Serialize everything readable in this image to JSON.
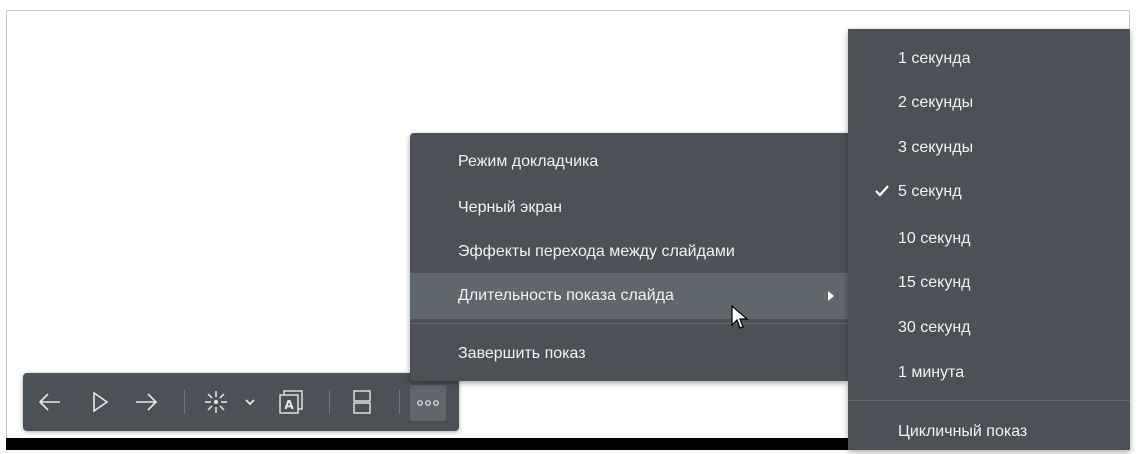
{
  "menu": {
    "items": [
      {
        "label": "Режим докладчика"
      },
      {
        "label": "Черный экран"
      },
      {
        "label": "Эффекты перехода между слайдами"
      },
      {
        "label": "Длительность показа слайда"
      },
      {
        "label": "Завершить показ"
      }
    ],
    "highlighted_index": 3
  },
  "submenu": {
    "items": [
      {
        "label": "1 секунда"
      },
      {
        "label": "2 секунды"
      },
      {
        "label": "3 секунды"
      },
      {
        "label": "5 секунд",
        "checked": true
      },
      {
        "label": "10 секунд"
      },
      {
        "label": "15 секунд"
      },
      {
        "label": "30 секунд"
      },
      {
        "label": "1 минута"
      },
      {
        "label": "Цикличный показ"
      }
    ]
  },
  "toolbar": {
    "buttons": [
      {
        "icon": "arrow-left-icon"
      },
      {
        "icon": "play-icon"
      },
      {
        "icon": "arrow-right-icon"
      },
      {
        "icon": "laser-pointer-icon"
      },
      {
        "icon": "chevron-down-icon"
      },
      {
        "icon": "slide-text-icon"
      },
      {
        "icon": "layout-split-icon"
      },
      {
        "icon": "more-icon"
      }
    ]
  },
  "colors": {
    "panel": "#4b5156",
    "highlight": "#5f666c",
    "text": "#f2f2f2"
  }
}
